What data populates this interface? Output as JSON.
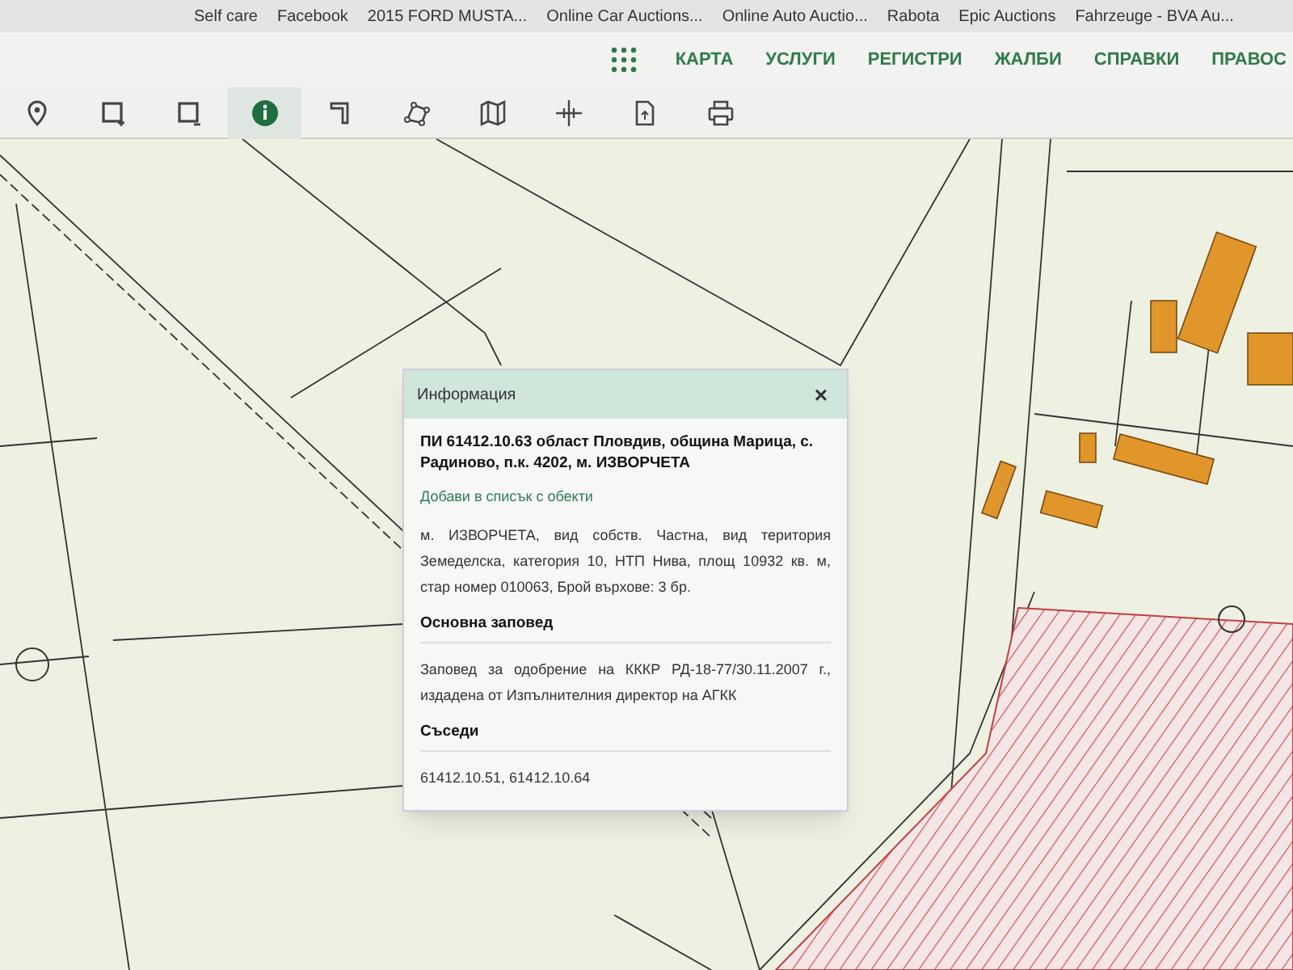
{
  "bookmarks": [
    {
      "label": "Self care"
    },
    {
      "label": "Facebook"
    },
    {
      "label": "2015 FORD MUSTA..."
    },
    {
      "label": "Online Car Auctions..."
    },
    {
      "label": "Online Auto Auctio..."
    },
    {
      "label": "Rabota"
    },
    {
      "label": "Epic Auctions"
    },
    {
      "label": "Fahrzeuge - BVA Au..."
    }
  ],
  "nav": {
    "items": [
      "КАРТА",
      "УСЛУГИ",
      "РЕГИСТРИ",
      "ЖАЛБИ",
      "СПРАВКИ",
      "ПРАВОС"
    ]
  },
  "toolbar": {
    "tools": [
      {
        "kind": "pin",
        "selected": false
      },
      {
        "kind": "rect-add",
        "selected": false
      },
      {
        "kind": "rect-remove",
        "selected": false
      },
      {
        "kind": "info",
        "selected": true
      },
      {
        "kind": "measure",
        "selected": false
      },
      {
        "kind": "polygon",
        "selected": false
      },
      {
        "kind": "map",
        "selected": false
      },
      {
        "kind": "crosshair",
        "selected": false
      },
      {
        "kind": "file",
        "selected": false
      },
      {
        "kind": "print",
        "selected": false
      }
    ]
  },
  "popup": {
    "title": "Информация",
    "close": "×",
    "heading": "ПИ 61412.10.63 област Пловдив, община Марица, с. Радиново, п.к. 4202, м. ИЗВОРЧЕТА",
    "link": "Добави в списък с обекти",
    "description": "м. ИЗВОРЧЕТА, вид собств. Частна, вид територия Земеделска, категория 10, НТП Нива, площ 10932 кв. м, стар номер 010063, Брой върхове: 3 бр.",
    "sections": [
      {
        "title": "Основна заповед",
        "text": "Заповед за одобрение на КККР РД-18-77/30.11.2007 г., издадена от Изпълнителния директор на АГКК"
      },
      {
        "title": "Съседи",
        "text": "61412.10.51, 61412.10.64"
      }
    ]
  }
}
